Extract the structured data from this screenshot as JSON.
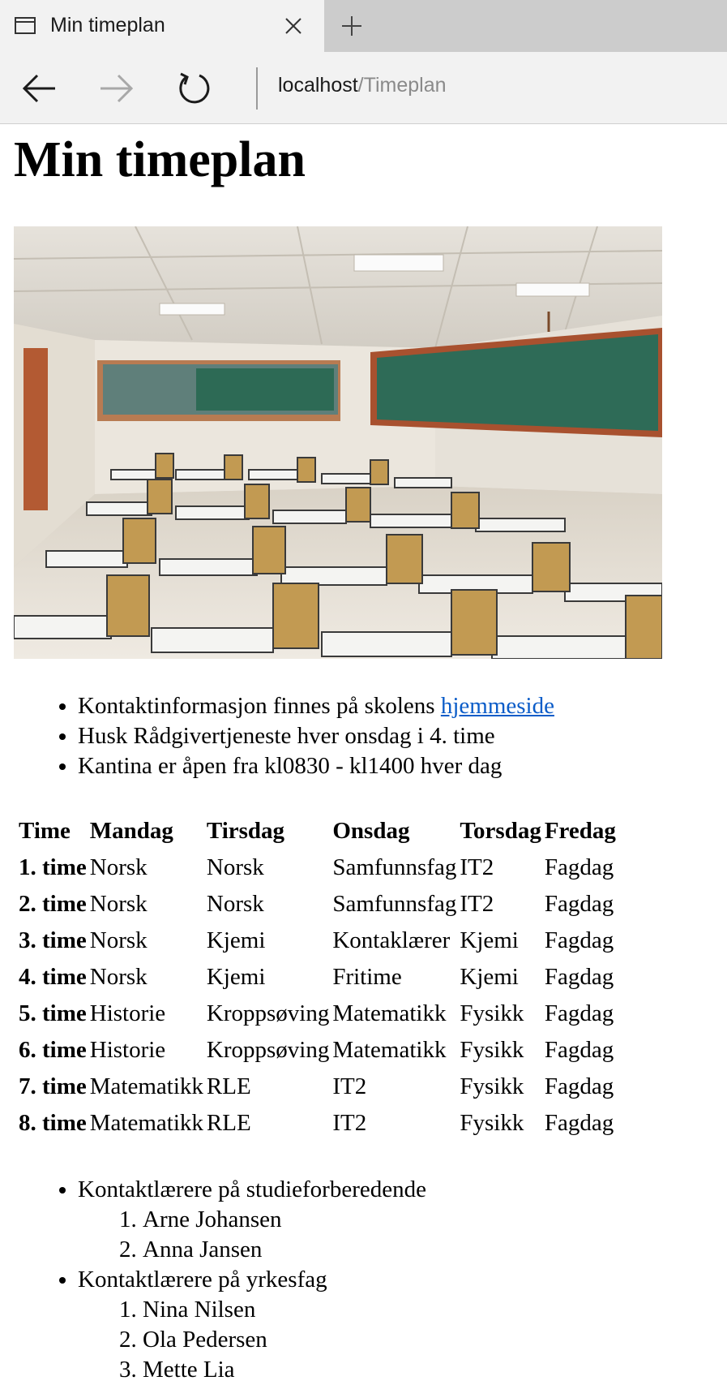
{
  "browser": {
    "tab_title": "Min timeplan",
    "address_host": "localhost",
    "address_path": "/Timeplan"
  },
  "page": {
    "heading": "Min timeplan",
    "notes": {
      "item1_prefix": "Kontaktinformasjon finnes på skolens ",
      "item1_link": "hjemmeside",
      "item2": "Husk Rådgivertjeneste hver onsdag i 4. time",
      "item3": "Kantina er åpen fra kl0830 - kl1400 hver dag"
    },
    "schedule": {
      "headers": [
        "Time",
        "Mandag",
        "Tirsdag",
        "Onsdag",
        "Torsdag",
        "Fredag"
      ],
      "rows": [
        [
          "1. time",
          "Norsk",
          "Norsk",
          "Samfunnsfag",
          "IT2",
          "Fagdag"
        ],
        [
          "2. time",
          "Norsk",
          "Norsk",
          "Samfunnsfag",
          "IT2",
          "Fagdag"
        ],
        [
          "3. time",
          "Norsk",
          "Kjemi",
          "Kontaklærer",
          "Kjemi",
          "Fagdag"
        ],
        [
          "4. time",
          "Norsk",
          "Kjemi",
          "Fritime",
          "Kjemi",
          "Fagdag"
        ],
        [
          "5. time",
          "Historie",
          "Kroppsøving",
          "Matematikk",
          "Fysikk",
          "Fagdag"
        ],
        [
          "6. time",
          "Historie",
          "Kroppsøving",
          "Matematikk",
          "Fysikk",
          "Fagdag"
        ],
        [
          "7. time",
          "Matematikk",
          "RLE",
          "IT2",
          "Fysikk",
          "Fagdag"
        ],
        [
          "8. time",
          "Matematikk",
          "RLE",
          "IT2",
          "Fysikk",
          "Fagdag"
        ]
      ]
    },
    "teachers": {
      "group1_label": "Kontaktlærere på studieforberedende",
      "group1": [
        "Arne Johansen",
        "Anna Jansen"
      ],
      "group2_label": "Kontaktlærere på yrkesfag",
      "group2": [
        "Nina Nilsen",
        "Ola Pedersen",
        "Mette Lia"
      ]
    }
  }
}
